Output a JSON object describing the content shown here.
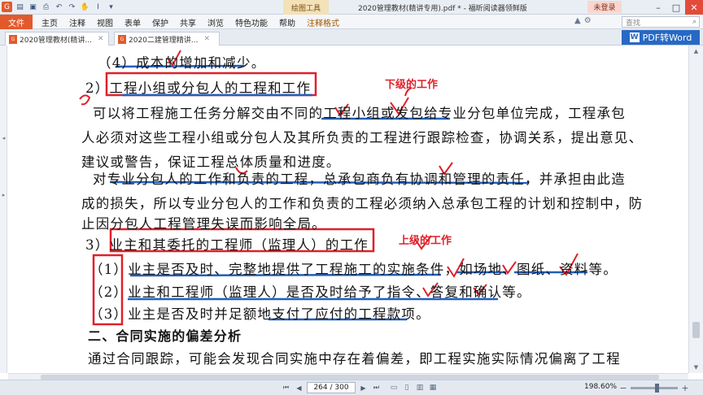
{
  "titlebar": {
    "context_tool": "绘图工具",
    "title": "2020管理教材(精讲专用).pdf * - 福昕阅读器领鲜版",
    "login": "未登录",
    "quick_icons": [
      "app-logo-icon",
      "open-icon",
      "save-icon",
      "print-icon",
      "undo-icon",
      "redo-icon",
      "hand-icon",
      "select-icon",
      "dropdown-icon"
    ]
  },
  "ribbon": {
    "file_tab": "文件",
    "tabs": [
      "主页",
      "注释",
      "视图",
      "表单",
      "保护",
      "共享",
      "浏览",
      "特色功能",
      "帮助",
      "注释格式"
    ],
    "search_placeholder": "查找"
  },
  "doc_tabs": [
    {
      "label": "2020管理教材(精讲..."
    },
    {
      "label": "2020二建管理精讲..."
    }
  ],
  "pdf_to_word": "PDF转Word",
  "content": {
    "lines": [
      "（4）成本的增加和减少。",
      "2）工程小组或分包人的工程和工作",
      "可以将工程施工任务分解交由不同的工程小组或发包给专业分包单位完成，工程承包",
      "人必须对这些工程小组或分包人及其所负责的工程进行跟踪检查，协调关系，提出意见、",
      "建议或警告，保证工程总体质量和进度。",
      "对专业分包人的工作和负责的工程，总承包商负有协调和管理的责任，并承担由此造",
      "成的损失，所以专业分包人的工作和负责的工程必须纳入总承包工程的计划和控制中，防",
      "止因分包人工程管理失误而影响全局。",
      "3）业主和其委托的工程师（监理人）的工作",
      "（1）业主是否及时、完整地提供了工程施工的实施条件，如场地、图纸、资料等。",
      "（2）业主和工程师（监理人）是否及时给予了指令、答复和确认等。",
      "（3）业主是否及时并足额地支付了应付的工程款项。",
      "二、合同实施的偏差分析",
      "通过合同跟踪，可能会发现合同实施中存在着偏差，即工程实施实际情况偏离了工程"
    ],
    "annotations": {
      "lower_work": "下级的工作",
      "upper_work": "上级的工作"
    },
    "markup_colors": {
      "red": "#e0202a",
      "blue": "#1f5fbf"
    }
  },
  "leftnav_icons": [
    "bookmark-icon",
    "thumbnails-icon",
    "layers-icon",
    "attachment-icon",
    "comments-icon"
  ],
  "statusbar": {
    "page": "264 / 300",
    "zoom": "198.60%"
  }
}
